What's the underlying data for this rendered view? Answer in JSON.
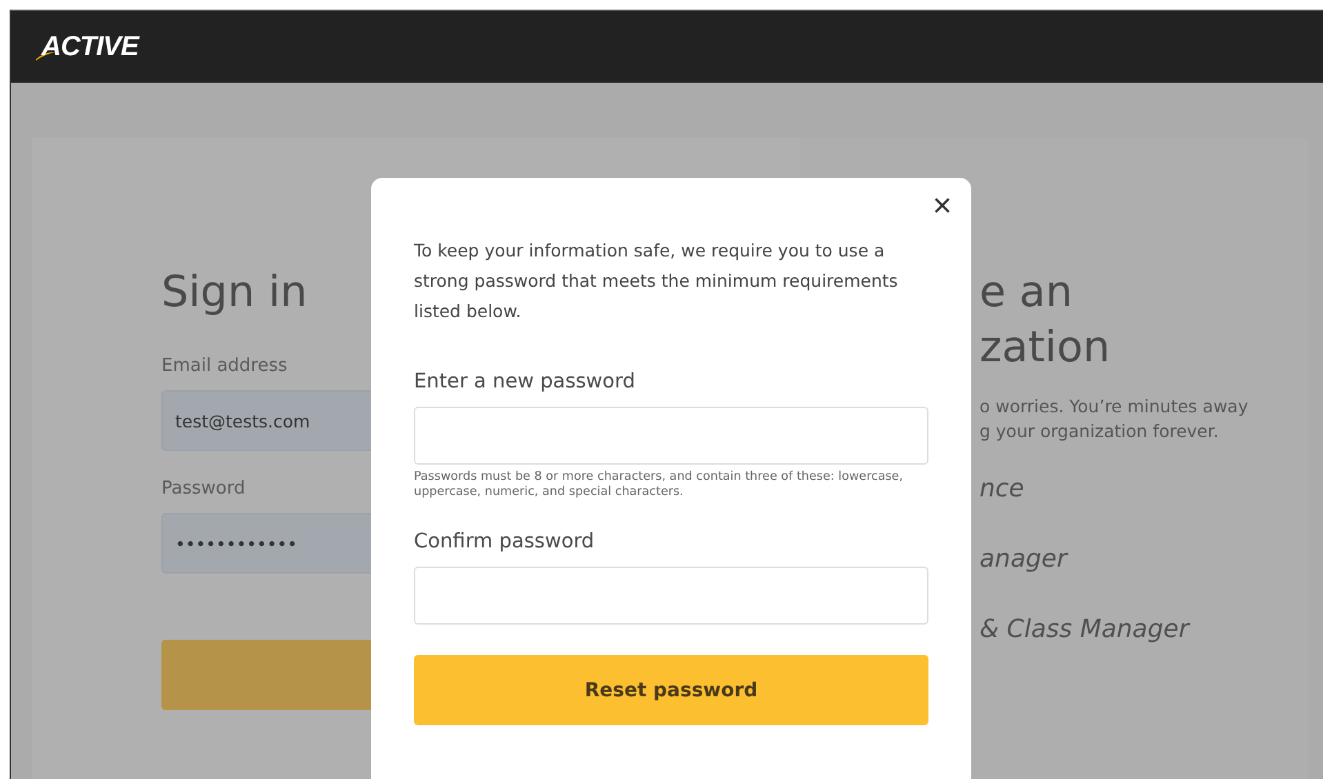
{
  "header": {
    "logo": "ACTIVE"
  },
  "sign_in": {
    "title": "Sign in",
    "email_label": "Email address",
    "email_value": "test@tests.com",
    "password_label": "Password",
    "password_value": "••••••••••••"
  },
  "organization_panel": {
    "title_lines": [
      "e an",
      "zation"
    ],
    "body_lines": [
      "o worries. You’re minutes away",
      "g your organization forever."
    ],
    "products": [
      "nce",
      "anager",
      "& Class Manager"
    ]
  },
  "dialog": {
    "message": "To keep your information safe, we require you to use a strong password that meets the minimum requirements listed below.",
    "new_password_label": "Enter a new password",
    "hint": "Passwords must be 8 or more characters, and contain three of these: lowercase, uppercase, numeric, and special characters.",
    "confirm_label": "Confirm password",
    "button": "Reset password",
    "close": "×"
  }
}
